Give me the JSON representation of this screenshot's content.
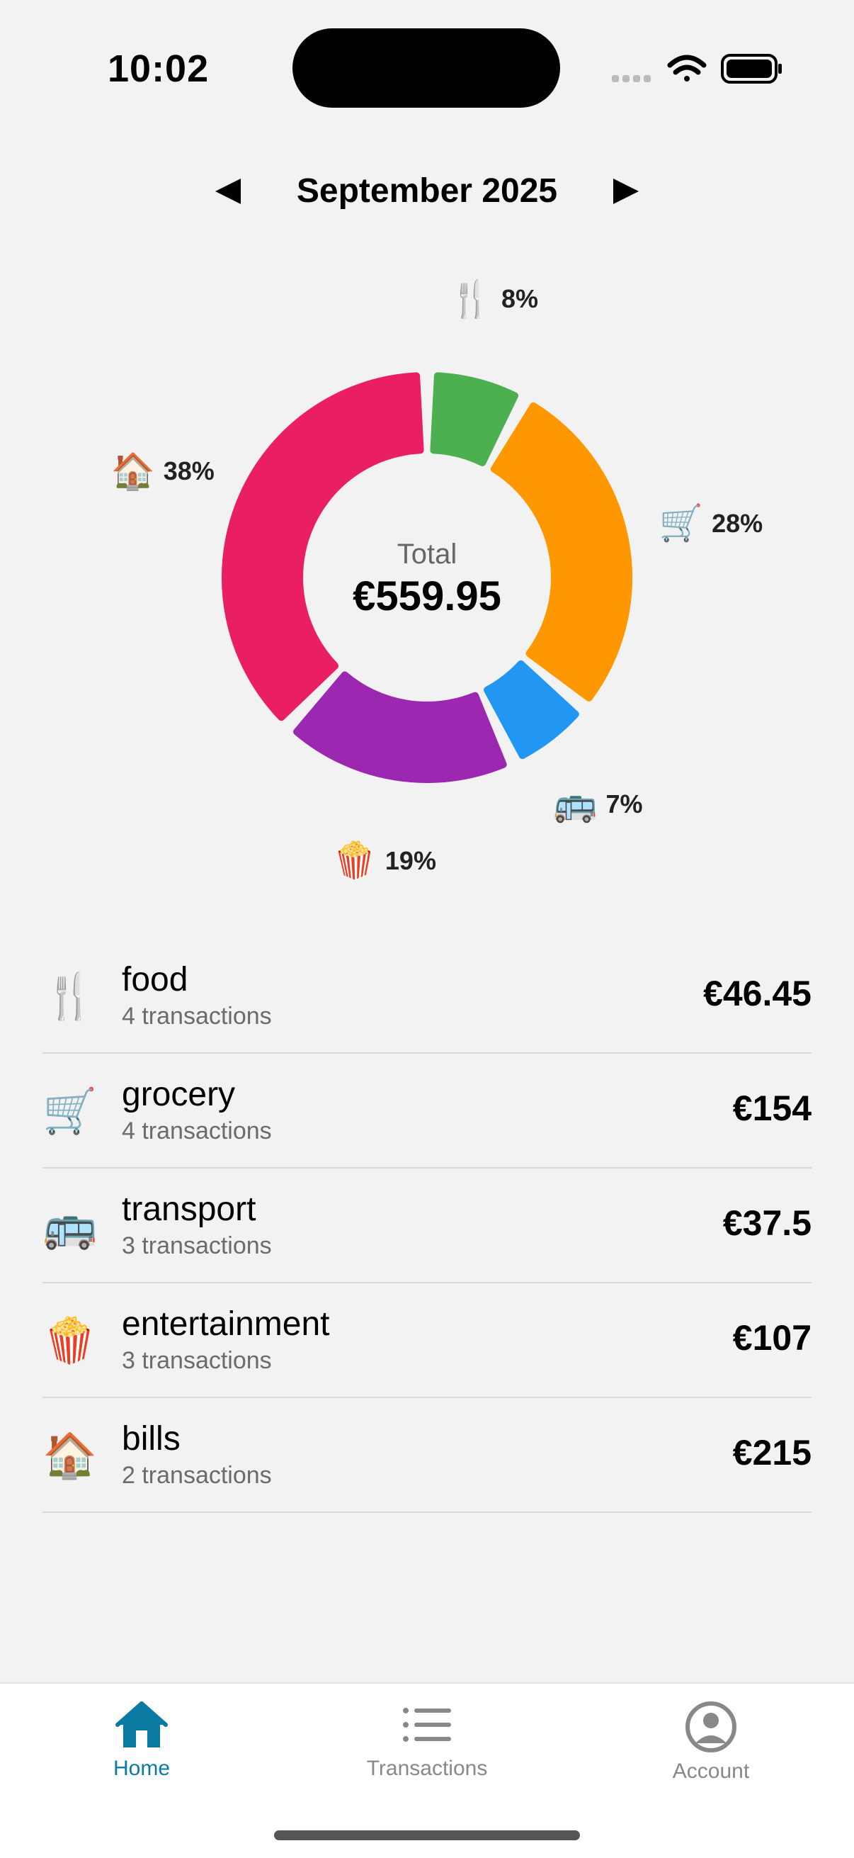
{
  "status_bar": {
    "time": "10:02"
  },
  "header": {
    "month": "September 2025"
  },
  "chart_data": {
    "type": "pie",
    "donut": true,
    "center_caption": "Total",
    "center_value": "€559.95",
    "slices": [
      {
        "category": "food",
        "icon": "🍴",
        "percent": 8,
        "label": "8%",
        "color": "#4caf50"
      },
      {
        "category": "grocery",
        "icon": "🛒",
        "percent": 28,
        "label": "28%",
        "color": "#ff9800"
      },
      {
        "category": "transport",
        "icon": "🚌",
        "percent": 7,
        "label": "7%",
        "color": "#2196f3"
      },
      {
        "category": "entertainment",
        "icon": "🍿",
        "percent": 19,
        "label": "19%",
        "color": "#9c27b0"
      },
      {
        "category": "bills",
        "icon": "🏠",
        "percent": 38,
        "label": "38%",
        "color": "#e91e63"
      }
    ]
  },
  "categories": [
    {
      "icon": "🍴",
      "name": "food",
      "count": "4 transactions",
      "amount": "€46.45"
    },
    {
      "icon": "🛒",
      "name": "grocery",
      "count": "4 transactions",
      "amount": "€154"
    },
    {
      "icon": "🚌",
      "name": "transport",
      "count": "3 transactions",
      "amount": "€37.5"
    },
    {
      "icon": "🍿",
      "name": "entertainment",
      "count": "3 transactions",
      "amount": "€107"
    },
    {
      "icon": "🏠",
      "name": "bills",
      "count": "2 transactions",
      "amount": "€215"
    }
  ],
  "tabs": {
    "home": {
      "label": "Home",
      "icon": "home-icon",
      "active": true,
      "color": "#0b7aa3"
    },
    "transactions": {
      "label": "Transactions",
      "icon": "list-icon"
    },
    "account": {
      "label": "Account",
      "icon": "account-icon"
    }
  }
}
